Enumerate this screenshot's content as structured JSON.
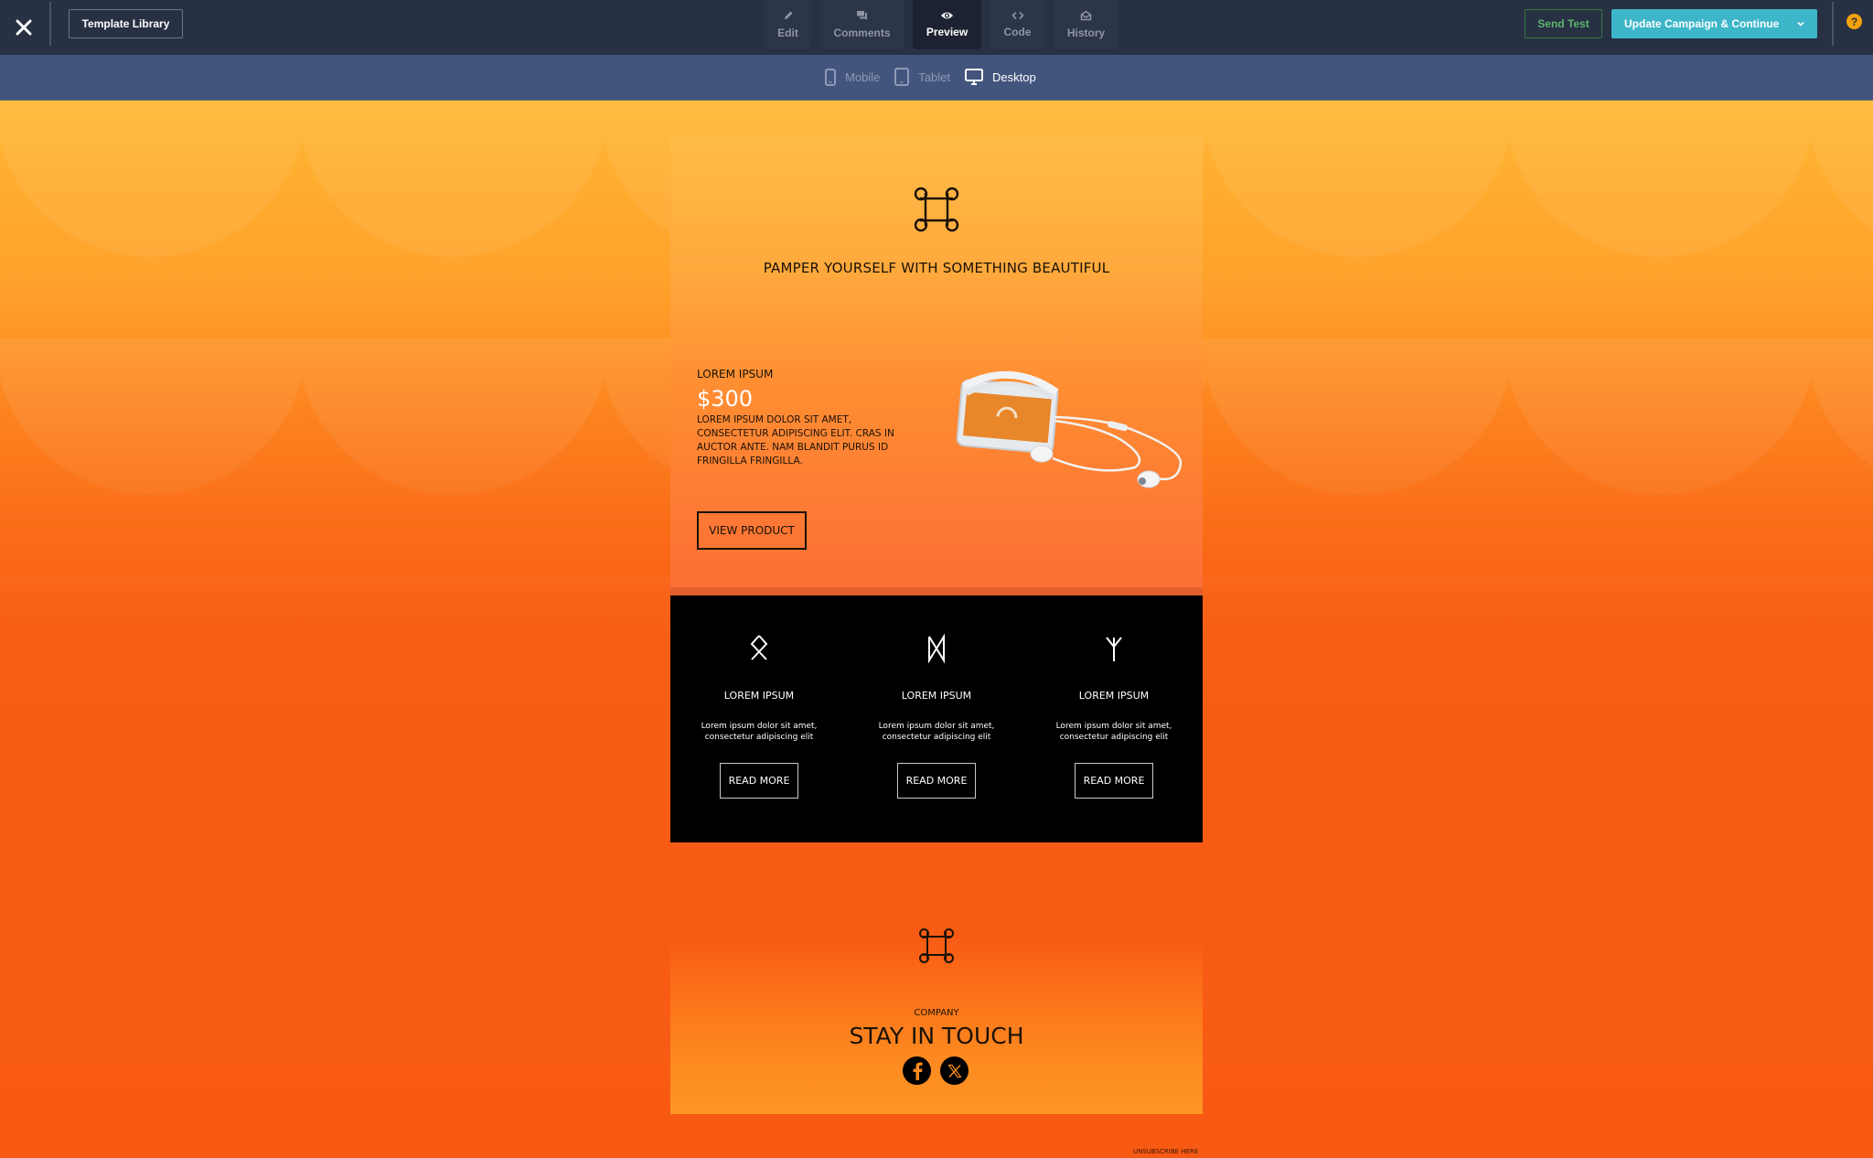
{
  "topbar": {
    "close_label": "Close",
    "template_library": "Template Library",
    "tabs": [
      {
        "label": "Edit",
        "icon": "pencil-icon",
        "active": false
      },
      {
        "label": "Comments",
        "icon": "comments-icon",
        "active": false
      },
      {
        "label": "Preview",
        "icon": "eye-icon",
        "active": true
      },
      {
        "label": "Code",
        "icon": "code-icon",
        "active": false
      },
      {
        "label": "History",
        "icon": "envelope-open-icon",
        "active": false
      }
    ],
    "send_test": "Send Test",
    "update_campaign": "Update Campaign & Continue",
    "help": "?"
  },
  "device_bar": {
    "devices": [
      {
        "label": "Mobile",
        "icon": "mobile-icon",
        "active": false
      },
      {
        "label": "Tablet",
        "icon": "tablet-icon",
        "active": false
      },
      {
        "label": "Desktop",
        "icon": "desktop-icon",
        "active": true
      }
    ]
  },
  "email": {
    "hero": {
      "icon": "command-key-icon",
      "title": "PAMPER YOURSELF WITH SOMETHING BEAUTIFUL",
      "product_label": "LOREM IPSUM",
      "price": "$300",
      "description": "LOREM IPSUM DOLOR SIT AMET, CONSECTETUR ADIPISCING ELIT. CRAS IN AUCTOR ANTE. NAM BLANDIT PURUS ID FRINGILLA FRINGILLA.",
      "button": "VIEW PRODUCT",
      "image": "smartphone-with-earphones"
    },
    "features": [
      {
        "icon": "othala-rune-icon",
        "title": "LOREM IPSUM",
        "text": "Lorem ipsum dolor sit amet, consectetur adipiscing elit",
        "button": "READ MORE"
      },
      {
        "icon": "dagaz-rune-icon",
        "title": "LOREM IPSUM",
        "text": "Lorem ipsum dolor sit amet, consectetur adipiscing elit",
        "button": "READ MORE"
      },
      {
        "icon": "algiz-rune-icon",
        "title": "LOREM IPSUM",
        "text": "Lorem ipsum dolor sit amet, consectetur adipiscing elit",
        "button": "READ MORE"
      }
    ],
    "footer": {
      "icon": "command-key-icon",
      "company": "COMPANY",
      "heading": "STAY IN TOUCH",
      "socials": [
        "facebook",
        "x"
      ],
      "unsubscribe": "UNSUBSCRIBE HERE"
    }
  },
  "colors": {
    "topbar_bg": "#283044",
    "device_bar_bg": "#42557d",
    "accent_button": "#3db6c9",
    "send_test_green": "#5bb56c",
    "help_orange": "#f5a20c",
    "canvas_orange": "#f85a14"
  }
}
